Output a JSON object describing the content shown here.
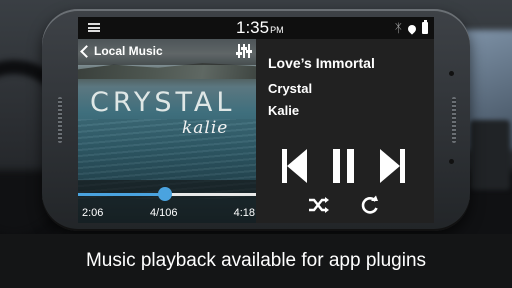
{
  "status_bar": {
    "time": "1:35",
    "ampm": "PM"
  },
  "header": {
    "title": "Local Music"
  },
  "album_art": {
    "title": "CRYSTAL",
    "artist": "kalie"
  },
  "playback": {
    "elapsed": "2:06",
    "track_counter": "4/106",
    "duration": "4:18",
    "progress_fraction": 0.49,
    "accent_color": "#4aa3df"
  },
  "track": {
    "title": "Love’s Immortal",
    "album": "Crystal",
    "artist": "Kalie"
  },
  "controls": {
    "previous": "previous-icon",
    "play_pause": "pause-icon",
    "next": "next-icon",
    "shuffle": "shuffle-icon",
    "repeat": "repeat-icon"
  },
  "caption": "Music playback available for app plugins"
}
